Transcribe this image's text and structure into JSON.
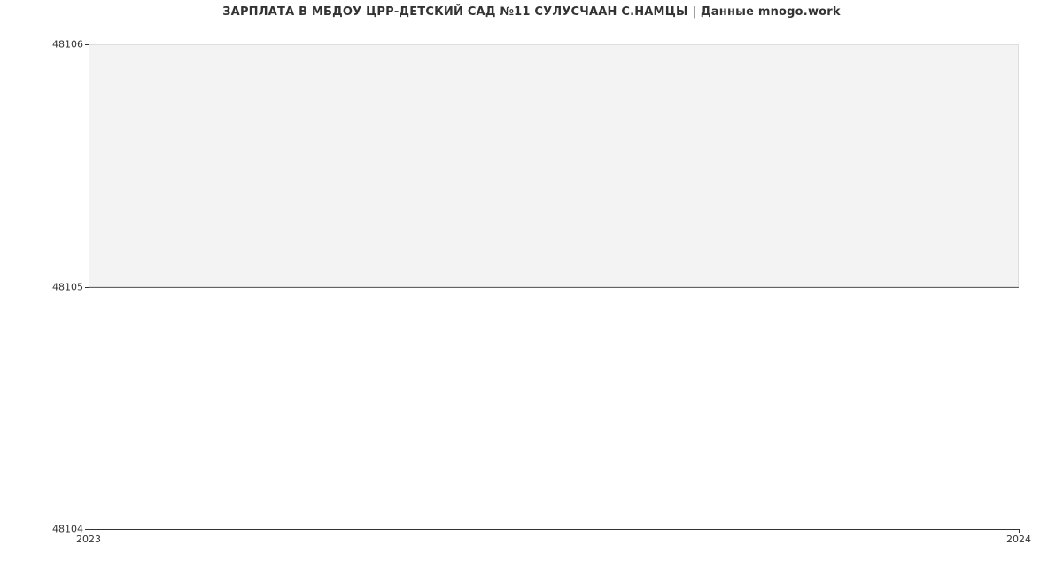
{
  "chart_data": {
    "type": "line",
    "title": "ЗАРПЛАТА В МБДОУ ЦРР-ДЕТСКИЙ САД №11 СУЛУСЧААН С.НАМЦЫ | Данные mnogo.work",
    "x": [
      2023,
      2024
    ],
    "values": [
      48105,
      48105
    ],
    "xlabel": "",
    "ylabel": "",
    "ylim": [
      48104,
      48106
    ],
    "yticks": [
      48104,
      48105,
      48106
    ],
    "xticks": [
      2023,
      2024
    ],
    "line_color": "#1f77b4",
    "shade_color": "#f3f3f3"
  },
  "ticks": {
    "y0": "48104",
    "y1": "48105",
    "y2": "48106",
    "x0": "2023",
    "x1": "2024"
  }
}
